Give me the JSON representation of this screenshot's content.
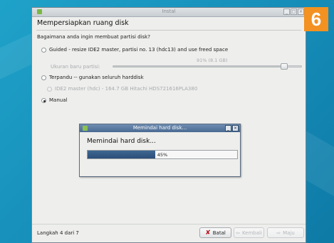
{
  "step_badge": "6",
  "window": {
    "title": "Instal",
    "heading": "Mempersiapkan ruang disk",
    "question": "Bagaimana anda ingin membuat partisi disk?",
    "options": {
      "guided_resize": "Guided - resize IDE2 master, partisi no. 13 (hdc13) and use freed space",
      "new_partition_size_label": "Ukuran baru partisi:",
      "resize_value": "91% (8.1 GB)",
      "resize_fraction": 0.91,
      "guided_full": "Terpandu -- gunakan seluruh harddisk",
      "disk_choice": "IDE2 master (hdc) - 164.7 GB Hitachi HDS721616PLA380",
      "manual": "Manual"
    },
    "selected_option": "manual",
    "footer": {
      "step": "Langkah 4 dari 7",
      "cancel": "Batal",
      "back": "Kembali",
      "forward": "Maju"
    }
  },
  "dialog": {
    "title": "Memindai hard disk...",
    "message": "Memindai hard disk...",
    "progress_text": "45%",
    "progress": 0.45
  },
  "colors": {
    "accent_badge": "#f39220",
    "progress_fill": "#2b4f78",
    "dialog_title": "#4a6a92"
  }
}
